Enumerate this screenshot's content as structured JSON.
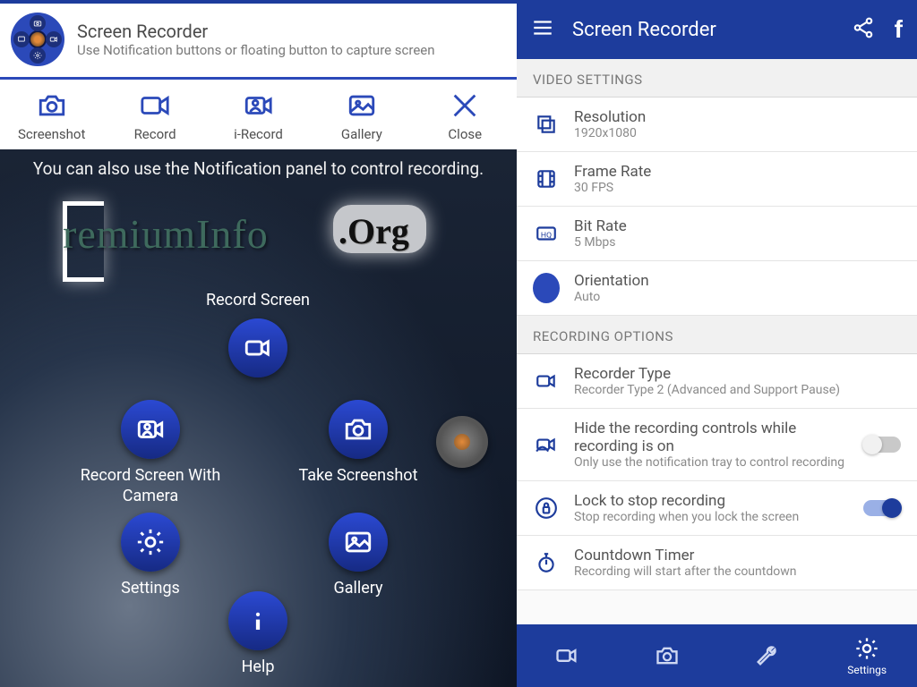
{
  "left": {
    "header": {
      "title": "Screen Recorder",
      "subtitle": "Use Notification buttons or floating button to capture screen"
    },
    "toolbar": {
      "screenshot": "Screenshot",
      "record": "Record",
      "irecord": "i-Record",
      "gallery": "Gallery",
      "close": "Close"
    },
    "overlay": {
      "hint": "You can also use the Notification panel to control recording.",
      "watermark_prefix": "remiumInfo",
      "watermark_suffix": ".Org"
    },
    "actions": {
      "record": "Record Screen",
      "record_cam": "Record Screen With Camera",
      "take_screenshot": "Take Screenshot",
      "settings": "Settings",
      "gallery": "Gallery",
      "help": "Help"
    }
  },
  "right": {
    "appbar": {
      "title": "Screen Recorder"
    },
    "sections": {
      "video": "VIDEO SETTINGS",
      "recopts": "RECORDING OPTIONS"
    },
    "items": {
      "resolution": {
        "name": "Resolution",
        "value": "1920x1080"
      },
      "framerate": {
        "name": "Frame Rate",
        "value": "30 FPS"
      },
      "bitrate": {
        "name": "Bit Rate",
        "value": "5 Mbps"
      },
      "orientation": {
        "name": "Orientation",
        "value": "Auto"
      },
      "rectype": {
        "name": "Recorder Type",
        "value": "Recorder Type 2 (Advanced and Support Pause)"
      },
      "hidecontrols": {
        "name": "Hide the recording controls while recording is on",
        "value": "Only use the notification tray to control recording"
      },
      "locktostop": {
        "name": "Lock to stop recording",
        "value": "Stop recording when you lock the screen"
      },
      "countdown": {
        "name": "Countdown Timer",
        "value": "Recording will start after the countdown"
      }
    },
    "bottomnav": {
      "settings_label": "Settings"
    }
  }
}
